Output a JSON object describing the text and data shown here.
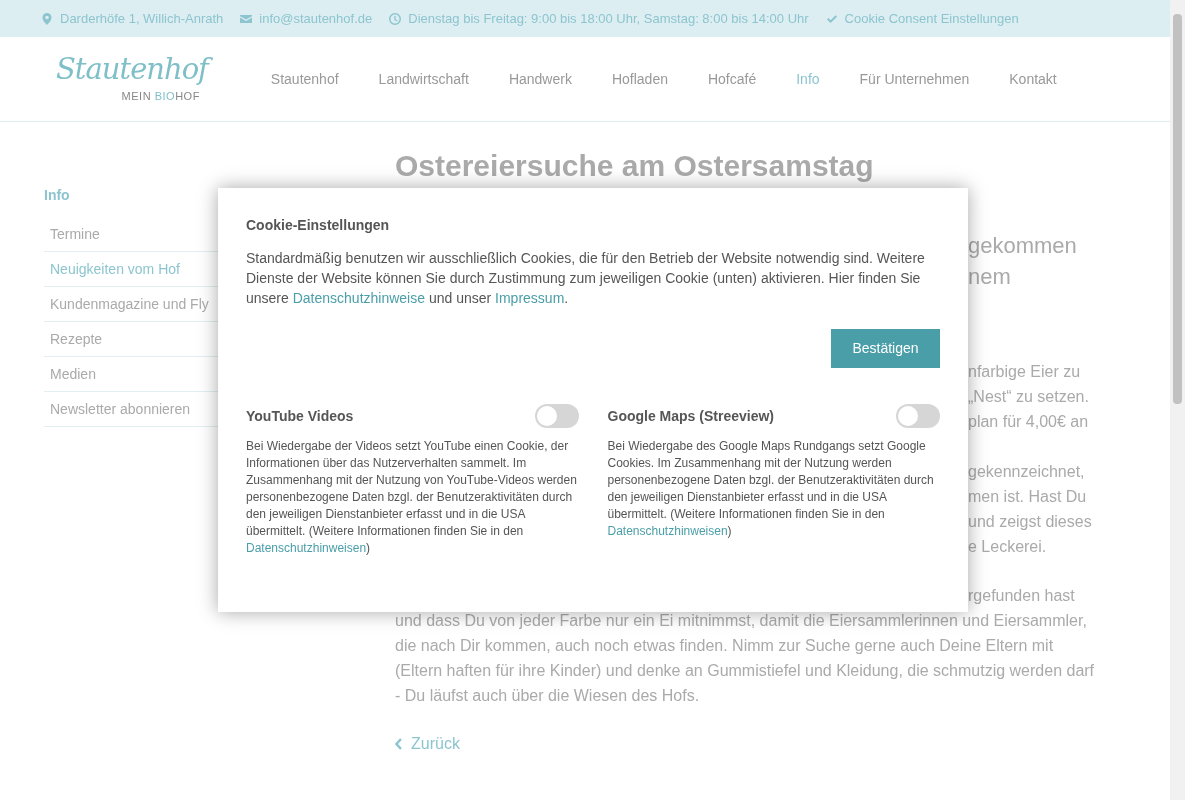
{
  "topbar": {
    "items": [
      {
        "kind": "pin",
        "text": "Darderhöfe 1, Willich-Anrath"
      },
      {
        "kind": "mail",
        "text": "info@stautenhof.de"
      },
      {
        "kind": "clock",
        "text": "Dienstag bis Freitag: 9:00 bis 18:00 Uhr, Samstag: 8:00 bis 14:00 Uhr"
      },
      {
        "kind": "check",
        "text": "Cookie Consent Einstellungen"
      }
    ]
  },
  "logo": {
    "script": "Stautenhof",
    "tagline": [
      {
        "text": "MEIN ",
        "highlight": false
      },
      {
        "text": "BIO",
        "highlight": true
      },
      {
        "text": "HOF",
        "highlight": false
      }
    ]
  },
  "nav": [
    {
      "label": "Stautenhof",
      "selected": false
    },
    {
      "label": "Landwirtschaft",
      "selected": false
    },
    {
      "label": "Handwerk",
      "selected": false
    },
    {
      "label": "Hofladen",
      "selected": false
    },
    {
      "label": "Hofcafé",
      "selected": false
    },
    {
      "label": "Info",
      "selected": true
    },
    {
      "label": "Für Unternehmen",
      "selected": false
    },
    {
      "label": "Kontakt",
      "selected": false
    }
  ],
  "sidebar": {
    "title": "Info",
    "items": [
      {
        "label": "Termine",
        "selected": false
      },
      {
        "label": "Neuigkeiten vom Hof",
        "selected": true
      },
      {
        "label": "Kundenmagazine und Fly",
        "selected": false
      },
      {
        "label": "Rezepte",
        "selected": false
      },
      {
        "label": "Medien",
        "selected": false
      },
      {
        "label": "Newsletter abonnieren",
        "selected": false
      }
    ]
  },
  "article": {
    "title": "Ostereiersuche am Ostersamstag",
    "lead": [
      "gekommen",
      "nem"
    ],
    "paragraphs": [
      [
        {
          "kind": "fragment",
          "text": "nfarbige Eier zu"
        },
        {
          "kind": "fragment",
          "text": "„Nest“ zu setzen."
        },
        {
          "kind": "fragment",
          "text": "plan für 4,00€ an"
        }
      ],
      [
        {
          "kind": "fragment",
          "text": "gekennzeichnet,"
        },
        {
          "kind": "fragment",
          "text": "men ist. Hast Du"
        },
        {
          "kind": "fragment",
          "text": "und zeigst dieses"
        },
        {
          "kind": "fragment",
          "text": "e Leckerei."
        }
      ],
      [
        {
          "kind": "fragment",
          "text": "rgefunden hast"
        },
        {
          "kind": "full",
          "text": "und dass Du von jeder Farbe nur ein Ei mitnimmst, damit die Eiersammlerinnen und Eiersammler,"
        },
        {
          "kind": "full",
          "text": "die nach Dir kommen, auch noch etwas finden. Nimm zur Suche gerne auch Deine Eltern mit"
        },
        {
          "kind": "full",
          "text": "(Eltern haften für ihre Kinder) und denke an Gummistiefel und Kleidung, die schmutzig werden darf"
        },
        {
          "kind": "full",
          "text": "- Du läufst auch über die Wiesen des Hofs."
        }
      ]
    ],
    "back": "Zurück"
  },
  "modal": {
    "title": "Cookie-Einstellungen",
    "intro": [
      {
        "kind": "text",
        "text": "Standardmäßig benutzen wir ausschließlich Cookies, die für den Betrieb der Website notwendig sind. Weitere Dienste der Website können Sie durch Zustimmung zum jeweiligen Cookie (unten) aktivieren. Hier finden Sie unsere "
      },
      {
        "kind": "link",
        "text": "Datenschutzhinweise"
      },
      {
        "kind": "text",
        "text": " und unser "
      },
      {
        "kind": "link",
        "text": "Impressum"
      },
      {
        "kind": "text",
        "text": "."
      }
    ],
    "confirm": "Bestätigen",
    "cookies": [
      {
        "title": "YouTube Videos",
        "on": false,
        "description": "Bei Wiedergabe der Videos setzt YouTube einen Cookie, der Informationen über das Nutzerverhalten sammelt. Im Zusammenhang mit der Nutzung von YouTube-Videos werden personenbezogene Daten bzgl. der Benutzeraktivitäten durch den jeweiligen Dienstanbieter erfasst und in die USA übermittelt. (Weitere Informationen finden Sie in den ",
        "link": "Datenschutzhinweisen",
        "after": ")"
      },
      {
        "title": "Google Maps (Streeview)",
        "on": false,
        "description": "Bei Wiedergabe des Google Maps Rundgangs setzt Google Cookies. Im Zusammenhang mit der Nutzung werden personenbezogene Daten bzgl. der Benutzeraktivitäten durch den jeweiligen Dienstanbieter erfasst und in die USA übermittelt. (Weitere Informationen finden Sie in den ",
        "link": "Datenschutzhinweisen",
        "after": ")"
      }
    ]
  }
}
